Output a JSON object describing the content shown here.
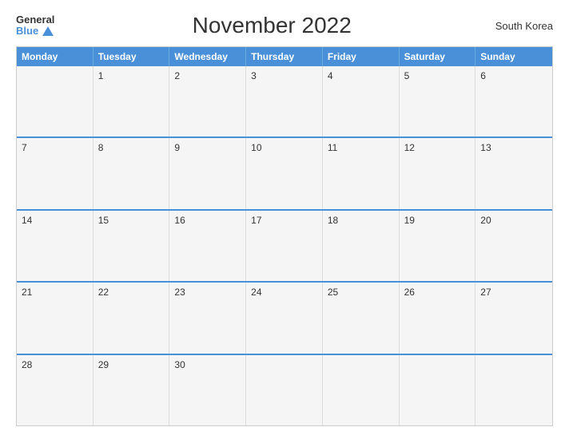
{
  "logo": {
    "general": "General",
    "blue": "Blue"
  },
  "title": "November 2022",
  "country": "South Korea",
  "weekdays": [
    "Monday",
    "Tuesday",
    "Wednesday",
    "Thursday",
    "Friday",
    "Saturday",
    "Sunday"
  ],
  "weeks": [
    [
      null,
      "1",
      "2",
      "3",
      "4",
      "5",
      "6"
    ],
    [
      "7",
      "8",
      "9",
      "10",
      "11",
      "12",
      "13"
    ],
    [
      "14",
      "15",
      "16",
      "17",
      "18",
      "19",
      "20"
    ],
    [
      "21",
      "22",
      "23",
      "24",
      "25",
      "26",
      "27"
    ],
    [
      "28",
      "29",
      "30",
      null,
      null,
      null,
      null
    ]
  ]
}
